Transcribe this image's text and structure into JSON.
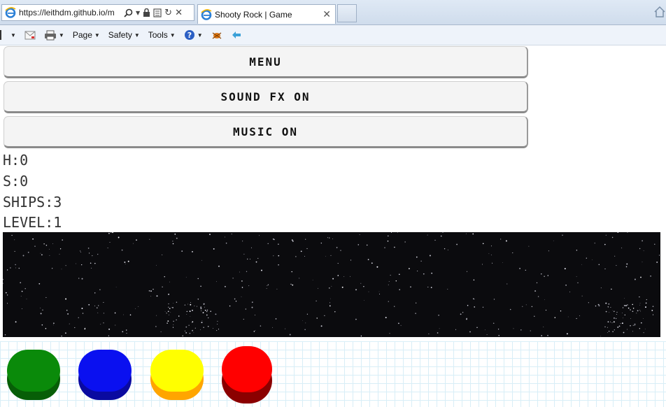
{
  "browser": {
    "address_url": "https://leithdm.github.io/m",
    "tab_title": "Shooty Rock | Game",
    "menu": {
      "page_label": "Page",
      "safety_label": "Safety",
      "tools_label": "Tools"
    }
  },
  "game": {
    "buttons": {
      "menu_label": "MENU",
      "sound_label": "SOUND FX ON",
      "music_label": "MUSIC ON"
    },
    "stats": {
      "hits": "H:0",
      "score": "S:0",
      "ships": "SHIPS:3",
      "level": "LEVEL:1"
    },
    "controls": [
      {
        "name": "green",
        "top_color": "#0a8a0a",
        "base_color": "#075e07"
      },
      {
        "name": "blue",
        "top_color": "#0a10f0",
        "base_color": "#0a0aa0"
      },
      {
        "name": "yellow",
        "top_color": "#ffff00",
        "base_color": "#ffa500"
      },
      {
        "name": "red",
        "top_color": "#ff0000",
        "base_color": "#8b0000"
      }
    ]
  }
}
